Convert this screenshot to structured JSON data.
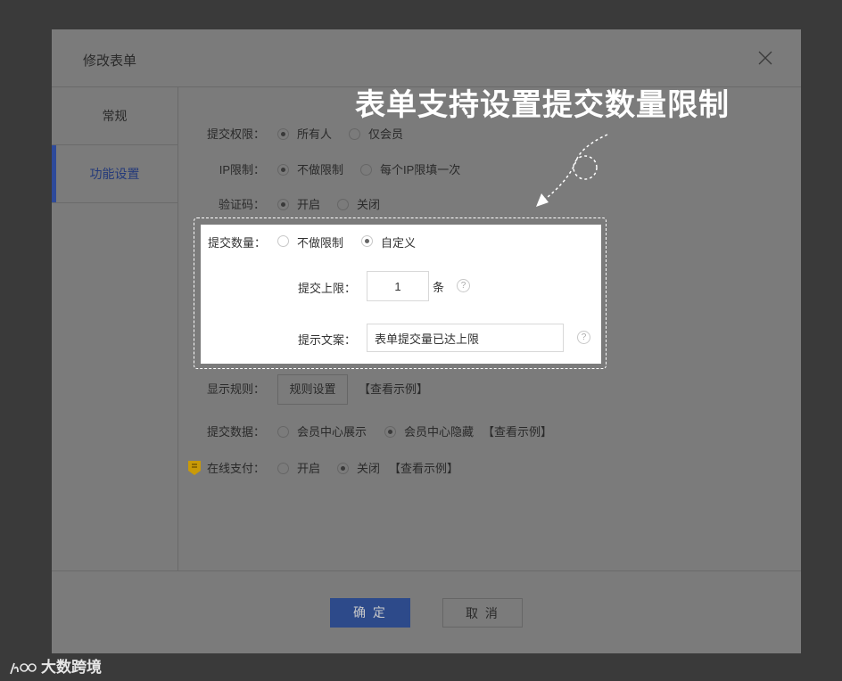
{
  "dialog": {
    "title": "修改表单",
    "close_icon": "close-icon"
  },
  "sidebar": {
    "items": [
      {
        "label": "常规",
        "active": false
      },
      {
        "label": "功能设置",
        "active": true
      }
    ]
  },
  "form": {
    "submit_permission": {
      "label": "提交权限：",
      "options": [
        "所有人",
        "仅会员"
      ],
      "selected": "所有人"
    },
    "ip_limit": {
      "label": "IP限制：",
      "options": [
        "不做限制",
        "每个IP限填一次"
      ],
      "selected": "不做限制"
    },
    "captcha": {
      "label": "验证码：",
      "options": [
        "开启",
        "关闭"
      ],
      "selected": "开启"
    },
    "submit_count": {
      "label": "提交数量：",
      "options": [
        "不做限制",
        "自定义"
      ],
      "selected": "自定义",
      "limit_label": "提交上限：",
      "limit_value": "1",
      "limit_unit": "条",
      "prompt_label": "提示文案：",
      "prompt_value": "表单提交量已达上限"
    },
    "display_rules": {
      "label": "显示规则：",
      "button": "规则设置",
      "example_link": "【查看示例】"
    },
    "submit_data": {
      "label": "提交数据：",
      "options": [
        "会员中心展示",
        "会员中心隐藏"
      ],
      "selected": "会员中心隐藏",
      "example_link": "【查看示例】"
    },
    "online_payment": {
      "label": "在线支付：",
      "options": [
        "开启",
        "关闭"
      ],
      "selected": "关闭",
      "example_link": "【查看示例】"
    }
  },
  "help_mark": "?",
  "footer": {
    "ok_label": "确 定",
    "cancel_label": "取 消"
  },
  "annotation": "表单支持设置提交数量限制",
  "watermark": "大数跨境",
  "colors": {
    "primary": "#2d4a8a",
    "overlay": "#7b7b7b",
    "badge": "#d6a100"
  }
}
